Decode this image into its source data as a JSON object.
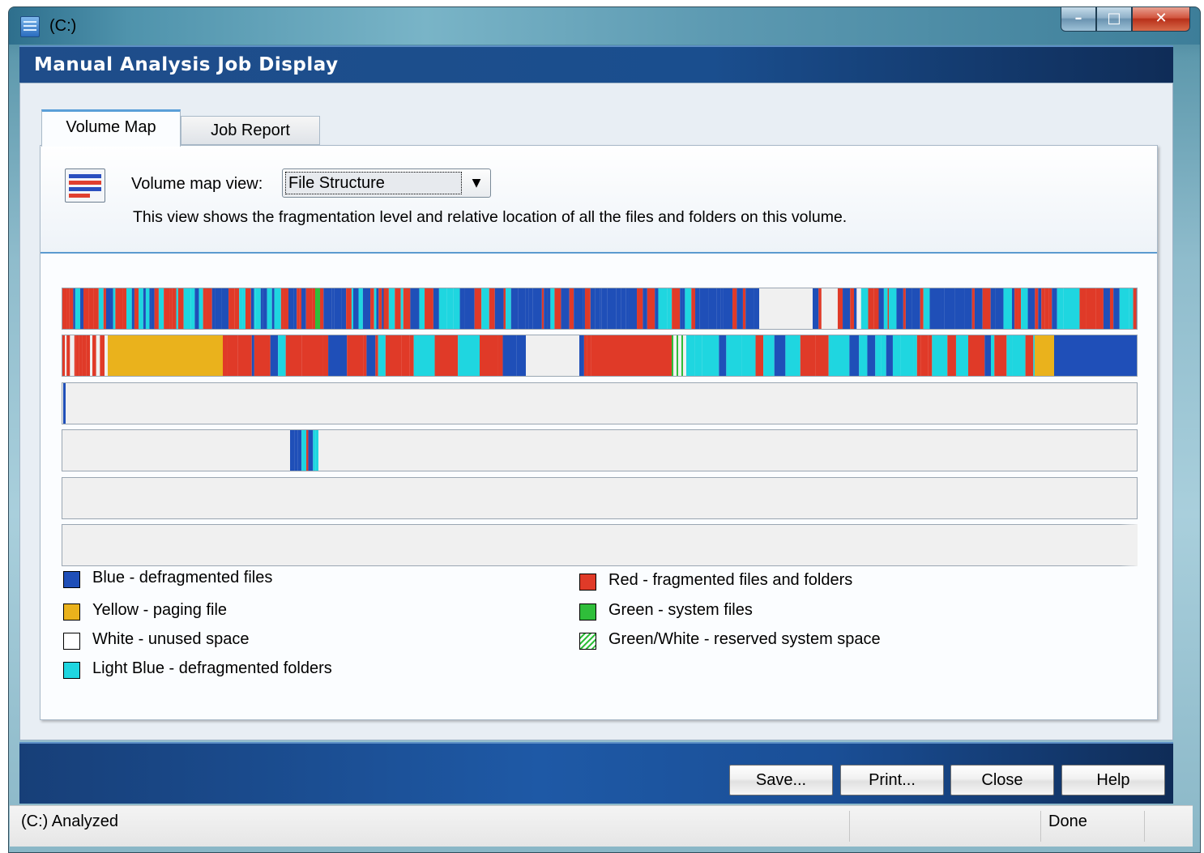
{
  "window": {
    "title": "(C:)"
  },
  "header": {
    "title": "Manual Analysis Job Display"
  },
  "tabs": [
    {
      "label": "Volume Map",
      "active": true
    },
    {
      "label": "Job Report",
      "active": false
    }
  ],
  "volume_map": {
    "view_label": "Volume map view:",
    "view_selected": "File Structure",
    "description": "This view shows the fragmentation level and relative location of all the files and folders on this volume."
  },
  "colors": {
    "blue": "#1f4fb8",
    "red": "#e03a28",
    "yellow": "#eab21c",
    "white": "#f0f0f0",
    "light_blue": "#1fd6e0",
    "green": "#2fbe3a"
  },
  "legend": {
    "left": [
      {
        "color": "#1f4fb8",
        "label": "Blue - defragmented files"
      },
      {
        "color": "#eab21c",
        "label": "Yellow - paging file"
      },
      {
        "color": "#ffffff",
        "label": "White - unused space"
      },
      {
        "color": "#1fd6e0",
        "label": "Light Blue - defragmented folders"
      }
    ],
    "right": [
      {
        "color": "#e03a28",
        "label": "Red - fragmented files and folders"
      },
      {
        "color": "#2fbe3a",
        "label": "Green - system files"
      },
      {
        "color": "hatch",
        "label": "Green/White - reserved system space"
      }
    ]
  },
  "buttons": {
    "save": {
      "label": "Save...",
      "mnemonic": "S"
    },
    "print": {
      "label": "Print...",
      "mnemonic": "P"
    },
    "close": {
      "label": "Close",
      "mnemonic": "C"
    },
    "help": {
      "label": "Help",
      "mnemonic": "H"
    }
  },
  "status": {
    "left": "(C:) Analyzed",
    "right": "Done"
  }
}
